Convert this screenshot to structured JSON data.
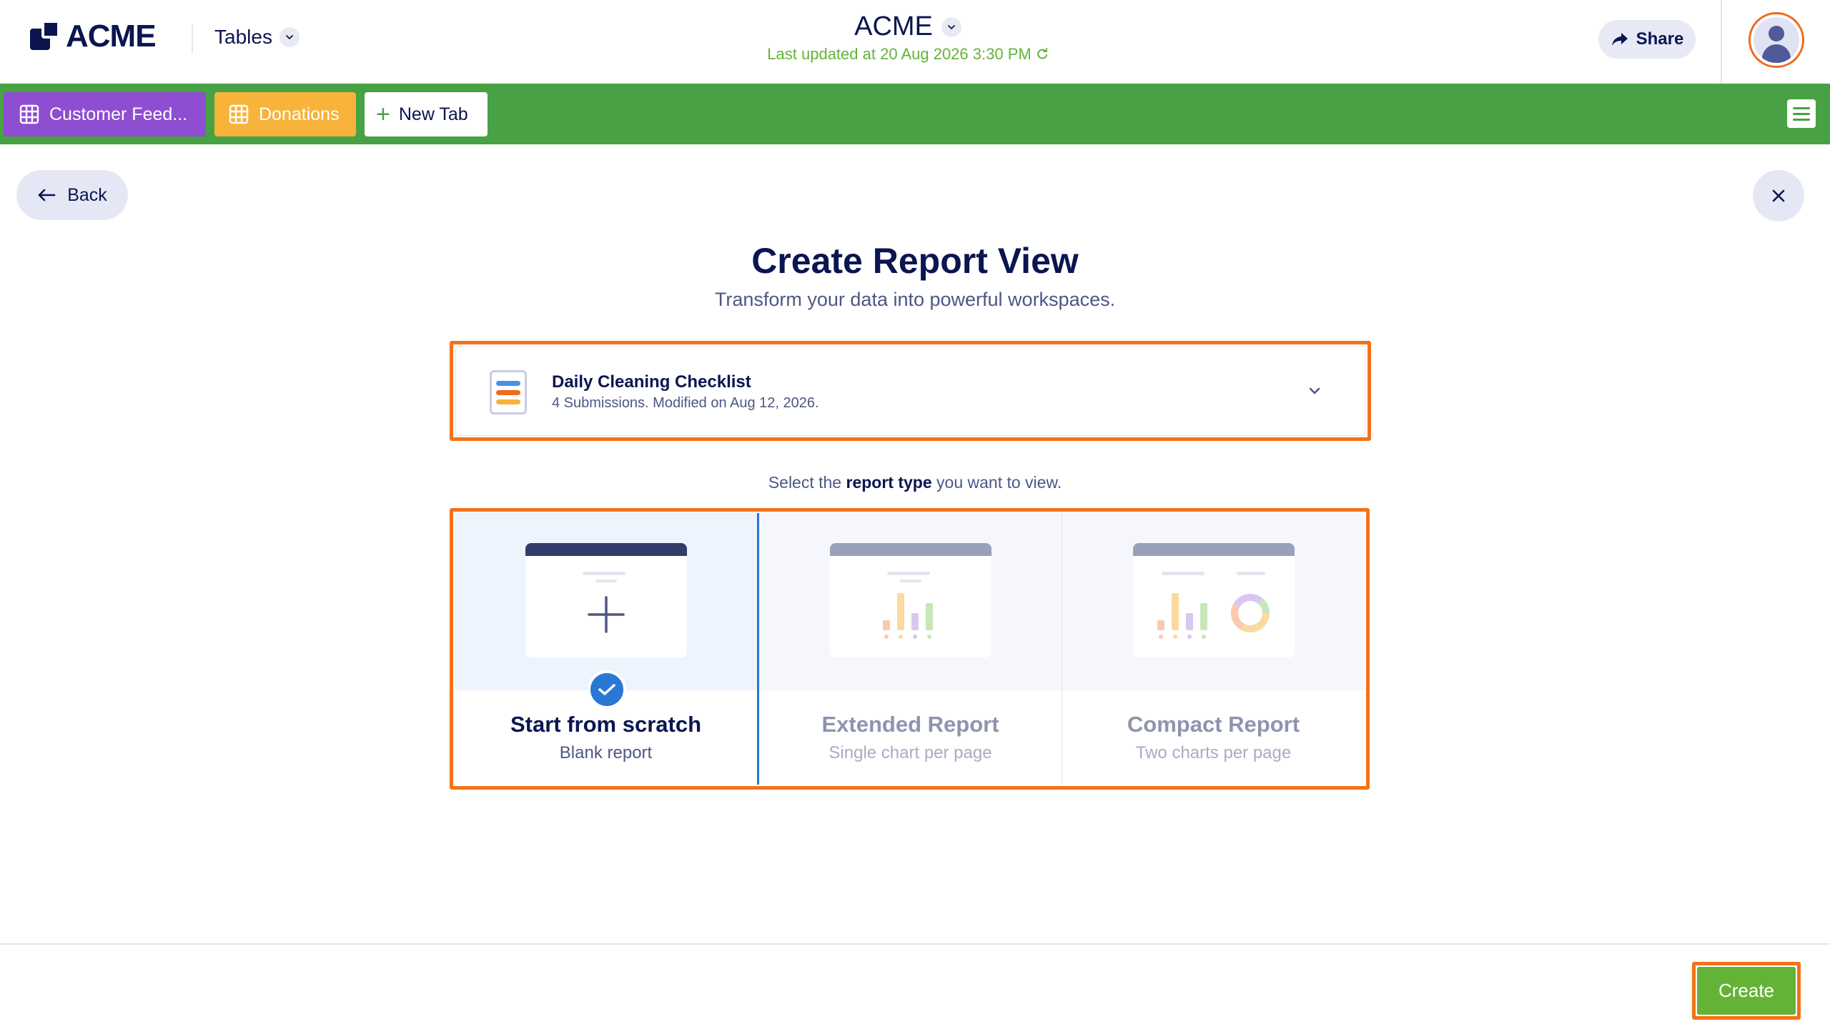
{
  "header": {
    "logo_text": "ACME",
    "product_menu": "Tables",
    "app_title": "ACME",
    "last_updated": "Last updated at 20 Aug 2026 3:30 PM",
    "share_label": "Share"
  },
  "tabs": [
    {
      "label": "Customer Feed...",
      "color": "#8f4dd2"
    },
    {
      "label": "Donations",
      "color": "#f8b33a"
    },
    {
      "label": "New Tab"
    }
  ],
  "nav": {
    "back_label": "Back"
  },
  "main": {
    "title": "Create Report View",
    "subtitle": "Transform your data into powerful workspaces.",
    "form_select": {
      "name": "Daily Cleaning Checklist",
      "meta": "4 Submissions. Modified on Aug 12, 2026."
    },
    "hint_prefix": "Select the ",
    "hint_bold": "report type",
    "hint_suffix": " you want to view.",
    "report_types": [
      {
        "title": "Start from scratch",
        "subtitle": "Blank report",
        "selected": true
      },
      {
        "title": "Extended Report",
        "subtitle": "Single chart per page",
        "selected": false
      },
      {
        "title": "Compact Report",
        "subtitle": "Two charts per page",
        "selected": false
      }
    ]
  },
  "footer": {
    "create_label": "Create"
  },
  "colors": {
    "header_green": "#48a144",
    "accent_orange": "#f37218",
    "create_green": "#64b337",
    "selected_blue": "#2a77d4",
    "navy": "#0a1551"
  }
}
